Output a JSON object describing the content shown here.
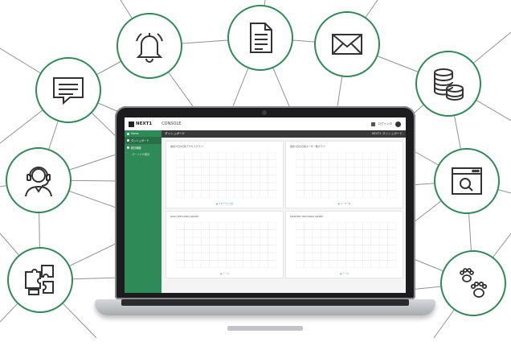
{
  "app": {
    "brand": "NEXT1",
    "section": "CONSOLE",
    "user": "ログイン中"
  },
  "sidebar": {
    "items": [
      {
        "label": "Home"
      },
      {
        "label": "ダッシュボード"
      },
      {
        "label": "統計機能"
      }
    ],
    "subitems": [
      {
        "label": "パーソナル統計"
      }
    ]
  },
  "header": {
    "title": "ダッシュボード",
    "right": "NEXT1 ダッシュボード"
  },
  "panels": [
    {
      "title": "過去7日の日別アクセスグラフ",
      "foot": "● 平均アクセス数"
    },
    {
      "title": "過去7日の日別ユーザー数グラフ",
      "foot": "● ユーザー数"
    },
    {
      "title": "DAILY RECORDS GRAPH",
      "foot": "● データ"
    },
    {
      "title": "MONTHLY RECORDS GRAPH",
      "foot": "● データ"
    }
  ],
  "icons": [
    "bell-icon",
    "document-icon",
    "mail-icon",
    "coins-icon",
    "chat-icon",
    "search-window-icon",
    "support-agent-icon",
    "paw-prints-icon",
    "puzzle-icon"
  ],
  "colors": {
    "accent": "#2e8b57",
    "ring": "#2f8a56"
  }
}
